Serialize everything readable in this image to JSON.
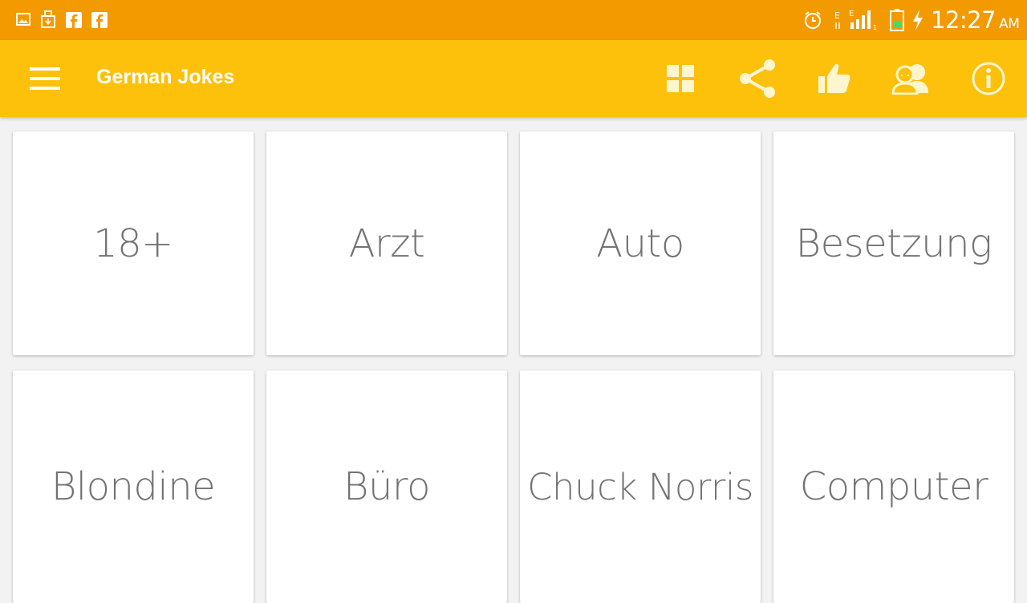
{
  "status_bar": {
    "time": "12:27",
    "ampm": "AM",
    "left_icons": [
      "gallery-icon",
      "usb-icon",
      "facebook-icon",
      "facebook-icon"
    ],
    "right_icons": [
      "alarm-icon",
      "network-e-icon",
      "signal-icon",
      "battery-charging-icon"
    ]
  },
  "toolbar": {
    "title": "German Jokes",
    "actions": [
      "menu-icon",
      "grid-icon",
      "share-icon",
      "thumbs-up-icon",
      "people-icon",
      "info-icon"
    ]
  },
  "categories": [
    {
      "label": "18+"
    },
    {
      "label": "Arzt"
    },
    {
      "label": "Auto"
    },
    {
      "label": "Besetzung"
    },
    {
      "label": "Blondine"
    },
    {
      "label": "Büro"
    },
    {
      "label": "Chuck Norris"
    },
    {
      "label": "Computer"
    }
  ],
  "colors": {
    "status_bar": "#f29a00",
    "toolbar": "#fdc10b",
    "toolbar_icon": "#fff6d0",
    "card_text": "#737373",
    "background": "#f2f2f2"
  }
}
